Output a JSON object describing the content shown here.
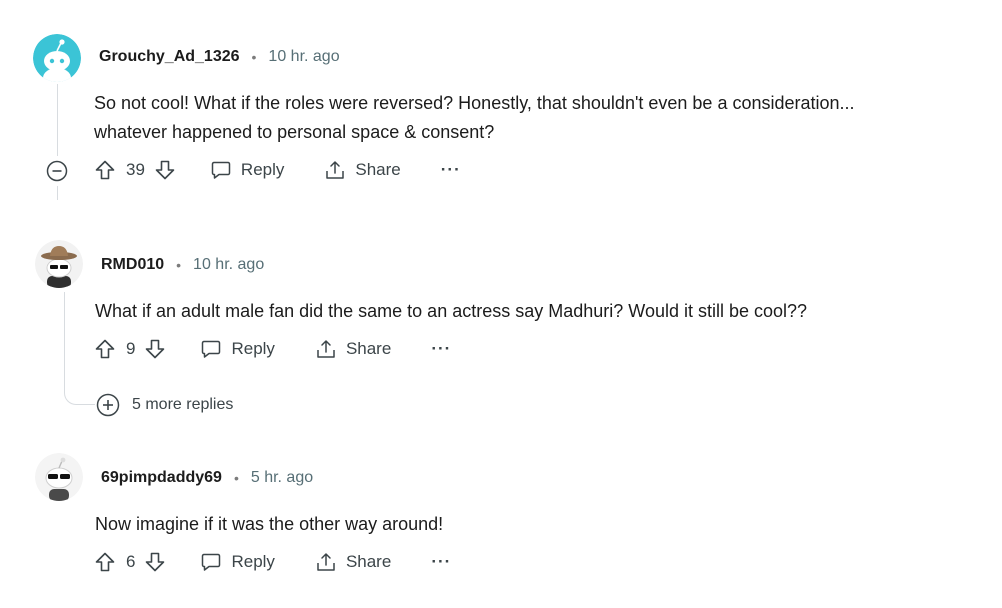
{
  "comments": [
    {
      "username": "Grouchy_Ad_1326",
      "separator": "•",
      "time": "10 hr. ago",
      "body_line1": "So not cool! What if the roles were reversed? Honestly, that shouldn't even be a consideration...",
      "body_line2": "whatever happened to personal space & consent?",
      "votes": "39",
      "reply_label": "Reply",
      "share_label": "Share",
      "more_label": "···",
      "avatar_color": "#3bc4d6"
    },
    {
      "username": "RMD010",
      "separator": "•",
      "time": "10 hr. ago",
      "body_line1": "What if an adult male fan did the same to an actress say Madhuri? Would it still be cool??",
      "votes": "9",
      "reply_label": "Reply",
      "share_label": "Share",
      "more_label": "···",
      "more_replies": "5 more replies"
    },
    {
      "username": "69pimpdaddy69",
      "separator": "•",
      "time": "5 hr. ago",
      "body_line1": "Now imagine if it was the other way around!",
      "votes": "6",
      "reply_label": "Reply",
      "share_label": "Share",
      "more_label": "···"
    }
  ]
}
